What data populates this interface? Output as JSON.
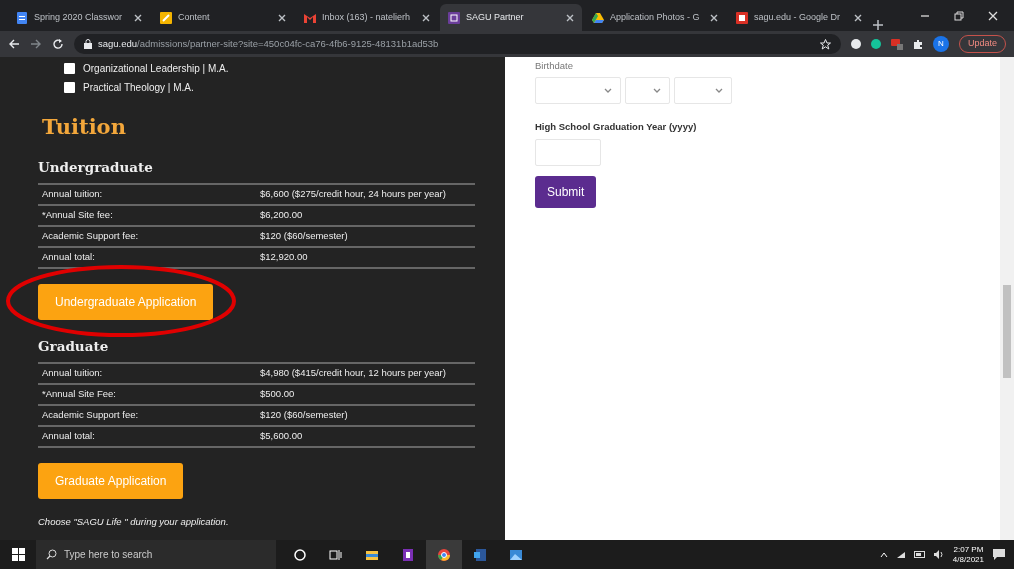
{
  "browser": {
    "tabs": [
      {
        "title": "Spring 2020 Classwor",
        "selected": false
      },
      {
        "title": "Content",
        "selected": false
      },
      {
        "title": "Inbox (163) - natelierh",
        "selected": false
      },
      {
        "title": "SAGU Partner",
        "selected": true
      },
      {
        "title": "Application Photos - G",
        "selected": false
      },
      {
        "title": "sagu.edu - Google Dr",
        "selected": false
      }
    ],
    "url_host": "sagu.edu",
    "url_path": "/admissions/partner-site?site=450c04fc-ca76-4fb6-9125-48131b1ad53b",
    "profile": "N",
    "update_label": "Update"
  },
  "programs": [
    {
      "label": "Organizational Leadership | M.A.",
      "checked": false
    },
    {
      "label": "Practical Theology | M.A.",
      "checked": false
    }
  ],
  "tuition": {
    "title": "Tuition",
    "sections": [
      {
        "heading": "Undergraduate",
        "rows": [
          [
            "Annual tuition:",
            "$6,600 ($275/credit hour, 24 hours per year)"
          ],
          [
            "*Annual Site fee:",
            "$6,200.00"
          ],
          [
            "Academic Support fee:",
            "$120 ($60/semester)"
          ],
          [
            "Annual total:",
            "$12,920.00"
          ]
        ],
        "button": "Undergraduate Application",
        "circled": true
      },
      {
        "heading": "Graduate",
        "rows": [
          [
            "Annual tuition:",
            "$4,980 ($415/credit hour, 12 hours per year)"
          ],
          [
            "*Annual Site Fee:",
            "$500.00"
          ],
          [
            "Academic Support fee:",
            "$120 ($60/semester)"
          ],
          [
            "Annual total:",
            "$5,600.00"
          ]
        ],
        "button": "Graduate Application",
        "circled": false
      }
    ],
    "note": "Choose \"SAGU Life \" during your application."
  },
  "form": {
    "birthdate_label": "Birthdate",
    "grad_year_label": "High School Graduation Year (yyyy)",
    "submit": "Submit"
  },
  "taskbar": {
    "search_placeholder": "Type here to search",
    "time": "2:07 PM",
    "date": "4/8/2021"
  }
}
